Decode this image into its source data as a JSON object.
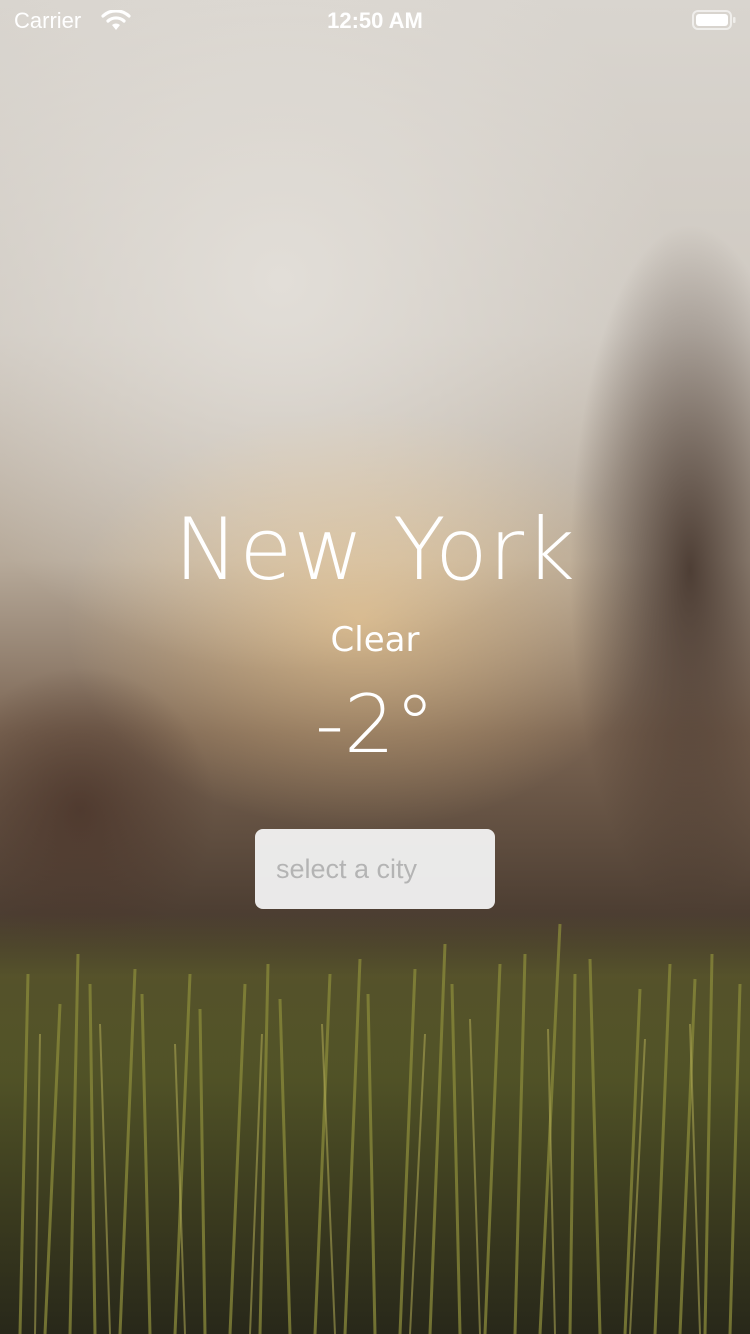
{
  "status_bar": {
    "carrier": "Carrier",
    "time": "12:50 AM",
    "wifi_icon": "wifi-icon",
    "battery_icon": "battery-icon"
  },
  "weather": {
    "city": "New York",
    "condition": "Clear",
    "temperature": "-2°"
  },
  "city_picker": {
    "placeholder": "select a city"
  },
  "background": {
    "description_icon": "sunset-grass-background"
  }
}
